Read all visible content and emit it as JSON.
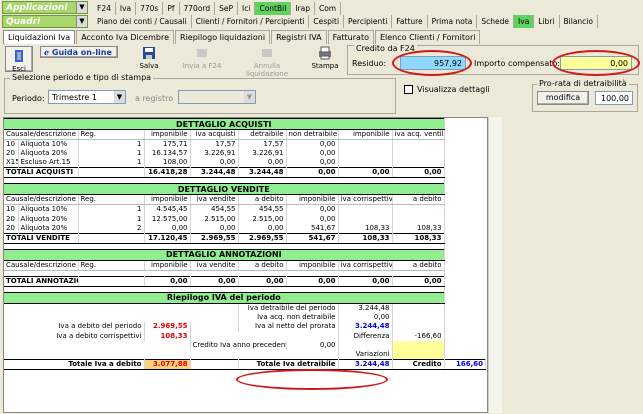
{
  "top_combo1": "Applicazioni",
  "top_combo2": "Quadri",
  "tabs_row1": [
    "F24",
    "Iva",
    "770s",
    "Pf",
    "770ord",
    "SeP",
    "Ici",
    "ContBil",
    "Irap",
    "Com"
  ],
  "tabs_row2": [
    "Piano dei conti / Causali",
    "Clienti / Fornitori / Percipienti",
    "Cespiti",
    "Percipienti",
    "Fatture",
    "Prima nota",
    "Schede",
    "Iva",
    "Libri",
    "Bilancio"
  ],
  "subtabs": [
    "Liquidazioni Iva",
    "Acconto Iva Dicembre",
    "Riepilogo liquidazioni",
    "Registri IVA",
    "Fatturato",
    "Elenco Clienti / Fornitori"
  ],
  "toolbar": {
    "esci": "Esci",
    "guida": "Guida on-line",
    "salva": "Salva",
    "invia": "Invia a F24",
    "annulla": "Annulla liquidazione",
    "stampa": "Stampa"
  },
  "credito": {
    "title": "Credito da F24",
    "residuo_label": "Residuo:",
    "residuo_value": "957,92",
    "importo_label": "Importo compensato:",
    "importo_value": "0,00"
  },
  "selezione": {
    "title": "Selezione periodo e tipo di stampa",
    "periodo_label": "Periodo:",
    "periodo_value": "Trimestre 1",
    "registro_label": "a registro",
    "visualizza": "Visualizza dettagli"
  },
  "prorata": {
    "title": "Pro-rata di detraibilità",
    "modifica": "modifica",
    "value": "100,00"
  },
  "acquisti": {
    "title": "DETTAGLIO ACQUISTI",
    "headers": [
      "Causale/descrizione",
      "Reg.",
      "imponibile",
      "iva acquisti",
      "detraibile",
      "non detraibile",
      "imponibile",
      "iva acq. ventilar"
    ],
    "rows": [
      [
        "10",
        "Aliquota 10%",
        "1",
        "175,71",
        "17,57",
        "17,57",
        "0,00",
        "",
        ""
      ],
      [
        "20",
        "Aliquota 20%",
        "1",
        "16.134,57",
        "3.226,91",
        "3.226,91",
        "0,00",
        "",
        ""
      ],
      [
        "X15",
        "Escluso Art.15",
        "1",
        "108,00",
        "0,00",
        "0,00",
        "0,00",
        "",
        ""
      ]
    ],
    "total": [
      "TOTALI ACQUISTI",
      "",
      "16.418,28",
      "3.244,48",
      "3.244,48",
      "0,00",
      "0,00",
      "0,00"
    ]
  },
  "vendite": {
    "title": "DETTAGLIO VENDITE",
    "headers": [
      "Causale/descrizione",
      "Reg.",
      "imponibile",
      "iva vendite",
      "a debito",
      "imponibile",
      "iva corrispettivi",
      "a debito"
    ],
    "rows": [
      [
        "10",
        "Aliquota 10%",
        "1",
        "4.545,45",
        "454,55",
        "454,55",
        "0,00",
        "",
        ""
      ],
      [
        "20",
        "Aliquota 20%",
        "1",
        "12.575,00",
        "2.515,00",
        "2.515,00",
        "0,00",
        "",
        ""
      ],
      [
        "20",
        "Aliquota 20%",
        "2",
        "0,00",
        "0,00",
        "0,00",
        "541,67",
        "108,33",
        "108,33"
      ]
    ],
    "total": [
      "TOTALI VENDITE",
      "",
      "17.120,45",
      "2.969,55",
      "2.969,55",
      "541,67",
      "108,33",
      "108,33"
    ]
  },
  "annotazioni": {
    "title": "DETTAGLIO ANNOTAZIONI",
    "headers": [
      "Causale/descrizione",
      "Reg.",
      "imponibile",
      "iva vendite",
      "a debito",
      "imponibile",
      "iva corrispettivi",
      "a debito"
    ],
    "total": [
      "TOTALI ANNOTAZIONI",
      "",
      "0,00",
      "0,00",
      "0,00",
      "0,00",
      "0,00",
      "0,00"
    ]
  },
  "riepilogo": {
    "title": "Riepilogo IVA del periodo",
    "iva_detraibile_label": "Iva detraibile del periodo",
    "iva_detraibile": "3.244,48",
    "iva_acq_nd_label": "Iva acq. non detraibile",
    "iva_acq_nd": "0,00",
    "iva_netto_label": "Iva al netto del prorata",
    "iva_netto": "3.244,48",
    "iva_debito_label": "Iva a debito del periodo",
    "iva_debito": "2.969,55",
    "iva_corr_label": "Iva a debito corrispettivi",
    "iva_corr": "108,33",
    "differenza_label": "Differenza",
    "differenza": "-166,60",
    "credito_prec_label": "Credito Iva anno precedente",
    "credito_prec": "0,00",
    "variazioni_label": "Variazioni",
    "tot_debito_label": "Totale Iva a debito",
    "tot_debito": "3.077,88",
    "tot_detraibile_label": "Totale Iva detraibile",
    "tot_detraibile": "3.244,48",
    "credito_label": "Credito",
    "credito": "166,60"
  }
}
